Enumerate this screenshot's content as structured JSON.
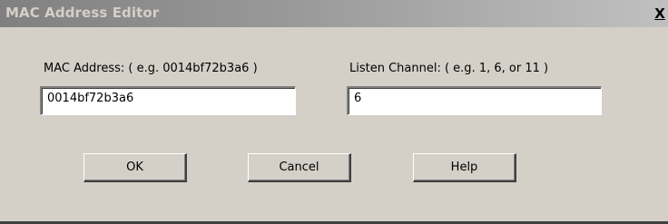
{
  "window": {
    "title": "MAC Address Editor",
    "close_glyph": "X"
  },
  "mac": {
    "label": "MAC Address: ( e.g.  0014bf72b3a6 )",
    "value": "0014bf72b3a6"
  },
  "channel": {
    "label": "Listen Channel: ( e.g. 1, 6, or 11 )",
    "value": "6"
  },
  "buttons": {
    "ok": "OK",
    "cancel": "Cancel",
    "help": "Help"
  },
  "colors": {
    "face": "#d4d0c8",
    "titlebar_inactive": "#808080"
  }
}
